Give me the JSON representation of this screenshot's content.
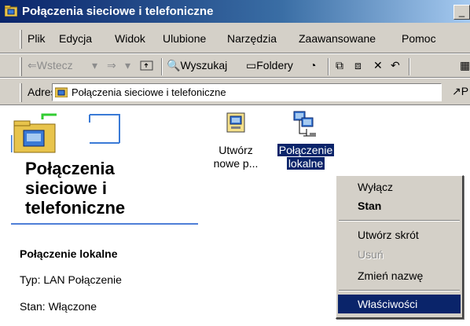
{
  "window": {
    "title": "Połączenia sieciowe i telefoniczne",
    "folder_icon": "network-folder-icon",
    "minimize_label": "_"
  },
  "menu": {
    "items": [
      "Plik",
      "Edycja",
      "Widok",
      "Ulubione",
      "Narzędzia",
      "Zaawansowane",
      "Pomoc"
    ]
  },
  "toolbar": {
    "back_label": "Wstecz",
    "search_label": "Wyszukaj",
    "folders_label": "Foldery"
  },
  "address": {
    "label": "Adres",
    "value": "Połączenia sieciowe i telefoniczne",
    "go_label": "P"
  },
  "webview": {
    "title": "Połączenia sieciowe i telefoniczne",
    "title_lines": [
      "Połączenia",
      "sieciowe i",
      "telefoniczne"
    ],
    "selected_name": "Połączenie lokalne",
    "type_text": "Typ: LAN Połączenie",
    "status_text": "Stan: Włączone"
  },
  "icons": [
    {
      "name": "new-connection",
      "label_lines": [
        "Utwórz",
        "nowe p..."
      ],
      "icon": "new-connection-icon",
      "selected": false
    },
    {
      "name": "local-connection",
      "label_lines": [
        "Połączenie",
        "lokalne"
      ],
      "icon": "lan-connection-icon",
      "selected": true
    }
  ],
  "context_menu": {
    "items": [
      {
        "label": "Wyłącz",
        "state": "normal"
      },
      {
        "label": "Stan",
        "state": "default"
      },
      {
        "label": "Utwórz skrót",
        "state": "normal"
      },
      {
        "label": "Usuń",
        "state": "disabled"
      },
      {
        "label": "Zmień nazwę",
        "state": "normal"
      },
      {
        "label": "Właściwości",
        "state": "highlighted"
      }
    ]
  },
  "colors": {
    "title_active": "#0a246a",
    "selection": "#0a246a",
    "face": "#d4d0c8",
    "accent_line": "#4f7fd7"
  }
}
